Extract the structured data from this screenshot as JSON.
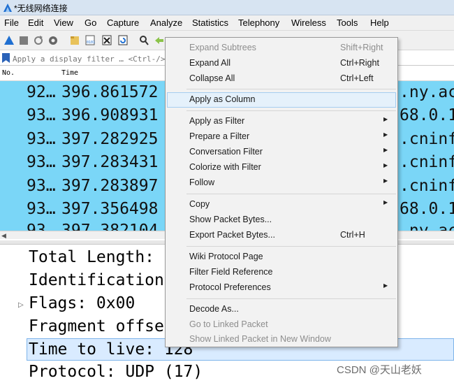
{
  "window": {
    "title": "*无线网络连接",
    "app_icon": "shark-fin-icon"
  },
  "menubar": {
    "items": [
      "File",
      "Edit",
      "View",
      "Go",
      "Capture",
      "Analyze",
      "Statistics",
      "Telephony",
      "Wireless",
      "Tools",
      "Help"
    ]
  },
  "toolbar": {
    "icons": [
      "stop-icon",
      "restart-icon",
      "options-icon",
      "open-file-icon",
      "save-file-icon",
      "close-file-icon",
      "reload-icon",
      "find-icon",
      "back-icon"
    ]
  },
  "filter": {
    "placeholder": "Apply a display filter … <Ctrl-/>"
  },
  "packet_list": {
    "columns": [
      "No.",
      "Time"
    ],
    "rows": [
      {
        "no": "92…",
        "time": "396.861572",
        "info": ".ny.ac"
      },
      {
        "no": "93…",
        "time": "396.908931",
        "info": "68.0.1"
      },
      {
        "no": "93…",
        "time": "397.282925",
        "info": ".cninf"
      },
      {
        "no": "93…",
        "time": "397.283431",
        "info": ".cninf"
      },
      {
        "no": "93…",
        "time": "397.283897",
        "info": ".cninf"
      },
      {
        "no": "93…",
        "time": "397.356498",
        "info": "68.0.1"
      },
      {
        "no": "93…",
        "time": "397.382104",
        "info": ".ny.ac"
      }
    ],
    "row_color": "#7ad6f7"
  },
  "details": {
    "lines": [
      "Total Length:",
      "Identification",
      "Flags: 0x00",
      "Fragment offse",
      "Time to live: 128",
      "Protocol: UDP (17)"
    ],
    "selected_index": 4
  },
  "context_menu": {
    "items": [
      {
        "label": "Expand Subtrees",
        "shortcut": "Shift+Right",
        "disabled": true
      },
      {
        "label": "Expand All",
        "shortcut": "Ctrl+Right"
      },
      {
        "label": "Collapse All",
        "shortcut": "Ctrl+Left"
      },
      {
        "label": "Apply as Column",
        "hover": true
      },
      {
        "label": "Apply as Filter",
        "submenu": true
      },
      {
        "label": "Prepare a Filter",
        "submenu": true
      },
      {
        "label": "Conversation Filter",
        "submenu": true
      },
      {
        "label": "Colorize with Filter",
        "submenu": true
      },
      {
        "label": "Follow",
        "submenu": true
      },
      {
        "label": "Copy",
        "submenu": true
      },
      {
        "label": "Show Packet Bytes..."
      },
      {
        "label": "Export Packet Bytes...",
        "shortcut": "Ctrl+H"
      },
      {
        "label": "Wiki Protocol Page"
      },
      {
        "label": "Filter Field Reference"
      },
      {
        "label": "Protocol Preferences",
        "submenu": true
      },
      {
        "label": "Decode As..."
      },
      {
        "label": "Go to Linked Packet",
        "disabled": true
      },
      {
        "label": "Show Linked Packet in New Window",
        "disabled": true
      }
    ]
  },
  "watermark": "CSDN @天山老妖"
}
